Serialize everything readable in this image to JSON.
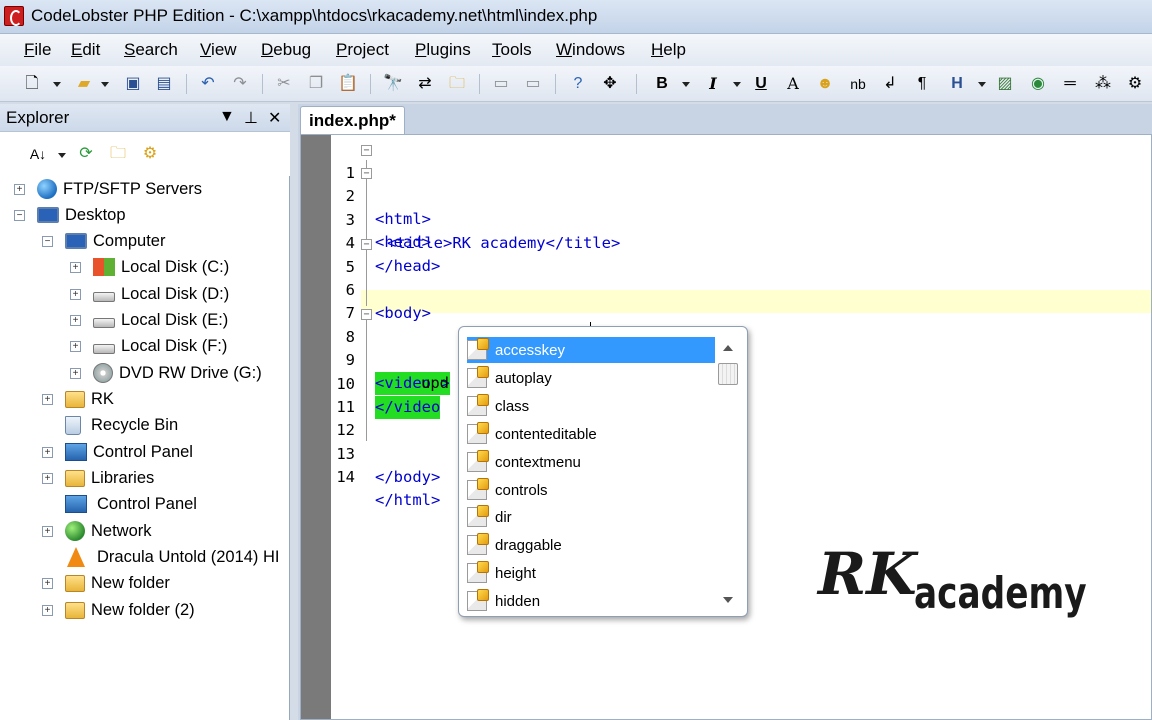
{
  "window": {
    "title": "CodeLobster PHP Edition - C:\\xampp\\htdocs\\rkacademy.net\\html\\index.php"
  },
  "menu": [
    {
      "label": "File",
      "u": "F",
      "rest": "ile"
    },
    {
      "label": "Edit",
      "u": "E",
      "rest": "dit"
    },
    {
      "label": "Search",
      "u": "S",
      "rest": "earch"
    },
    {
      "label": "View",
      "u": "V",
      "rest": "iew"
    },
    {
      "label": "Debug",
      "u": "D",
      "rest": "ebug"
    },
    {
      "label": "Project",
      "u": "P",
      "rest": "roject"
    },
    {
      "label": "Plugins",
      "u": "P",
      "rest": "lugins"
    },
    {
      "label": "Tools",
      "u": "T",
      "rest": "ools"
    },
    {
      "label": "Windows",
      "u": "W",
      "rest": "indows"
    },
    {
      "label": "Help",
      "u": "H",
      "rest": "elp"
    }
  ],
  "toolbar": {
    "icons": [
      "new-file-icon",
      "open-folder-icon",
      "save-icon",
      "save-all-icon",
      "undo-icon",
      "redo-icon",
      "cut-icon",
      "copy-icon",
      "paste-icon",
      "find-icon",
      "find-replace-icon",
      "find-in-files-icon",
      "panel-left-icon",
      "panel-right-icon",
      "help-icon",
      "fullscreen-icon",
      "bold-icon",
      "italic-icon",
      "underline-icon",
      "font-icon",
      "emoji-icon",
      "nbsp-icon",
      "line-break-icon",
      "paragraph-icon",
      "heading-icon",
      "image-icon",
      "globe-icon",
      "horizontal-rule-icon",
      "special-char-icon",
      "settings-icon"
    ]
  },
  "explorer": {
    "title": "Explorer",
    "tree": [
      {
        "label": "FTP/SFTP Servers",
        "icon": "ftp-globe-icon",
        "box": "+"
      },
      {
        "label": "Desktop",
        "icon": "desktop-icon",
        "box": "−"
      },
      {
        "label": "Computer",
        "icon": "computer-icon",
        "box": "−"
      },
      {
        "label": "Local Disk (C:)",
        "icon": "windows-disk-icon",
        "box": "+"
      },
      {
        "label": "Local Disk (D:)",
        "icon": "disk-icon",
        "box": "+"
      },
      {
        "label": "Local Disk (E:)",
        "icon": "disk-icon",
        "box": "+"
      },
      {
        "label": "Local Disk (F:)",
        "icon": "disk-icon",
        "box": "+"
      },
      {
        "label": "DVD RW Drive (G:)",
        "icon": "dvd-drive-icon",
        "box": "+"
      },
      {
        "label": "RK",
        "icon": "user-folder-icon",
        "box": "+"
      },
      {
        "label": "Recycle Bin",
        "icon": "recycle-bin-icon",
        "box": ""
      },
      {
        "label": "Control Panel",
        "icon": "control-panel-icon",
        "box": "+"
      },
      {
        "label": "Libraries",
        "icon": "libraries-icon",
        "box": "+"
      },
      {
        "label": "Control Panel",
        "icon": "control-panel-icon",
        "box": ""
      },
      {
        "label": "Network",
        "icon": "network-icon",
        "box": "+"
      },
      {
        "label": "Dracula Untold (2014) HI",
        "icon": "vlc-cone-icon",
        "box": ""
      },
      {
        "label": "New folder",
        "icon": "folder-icon",
        "box": "+"
      },
      {
        "label": "New folder (2)",
        "icon": "folder-icon",
        "box": "+"
      }
    ]
  },
  "editor": {
    "tab_label": "index.php*",
    "lines": [
      {
        "n": "1",
        "text": "<html>"
      },
      {
        "n": "2",
        "text": "<head>"
      },
      {
        "n": "3",
        "text": "<title>RK academy</title>"
      },
      {
        "n": "4",
        "text": "</head>"
      },
      {
        "n": "5",
        "text": "<body>"
      },
      {
        "n": "6",
        "text": ""
      },
      {
        "n": "7",
        "text": ""
      },
      {
        "n": "8",
        "text": "<video >"
      },
      {
        "n": "9",
        "text": "upd"
      },
      {
        "n": "10",
        "text": "</video"
      },
      {
        "n": "11",
        "text": ""
      },
      {
        "n": "12",
        "text": ""
      },
      {
        "n": "13",
        "text": "</body>"
      },
      {
        "n": "14",
        "text": "</html>"
      }
    ]
  },
  "autocomplete": {
    "items": [
      "accesskey",
      "autoplay",
      "class",
      "contenteditable",
      "contextmenu",
      "controls",
      "dir",
      "draggable",
      "height",
      "hidden"
    ],
    "selected_index": 0
  },
  "watermark": {
    "logo": "RK",
    "text": "academy"
  },
  "colors": {
    "tag": "#0000d0",
    "selection": "#3399ff",
    "match_highlight": "#22dd22",
    "current_line": "#ffffd0"
  }
}
